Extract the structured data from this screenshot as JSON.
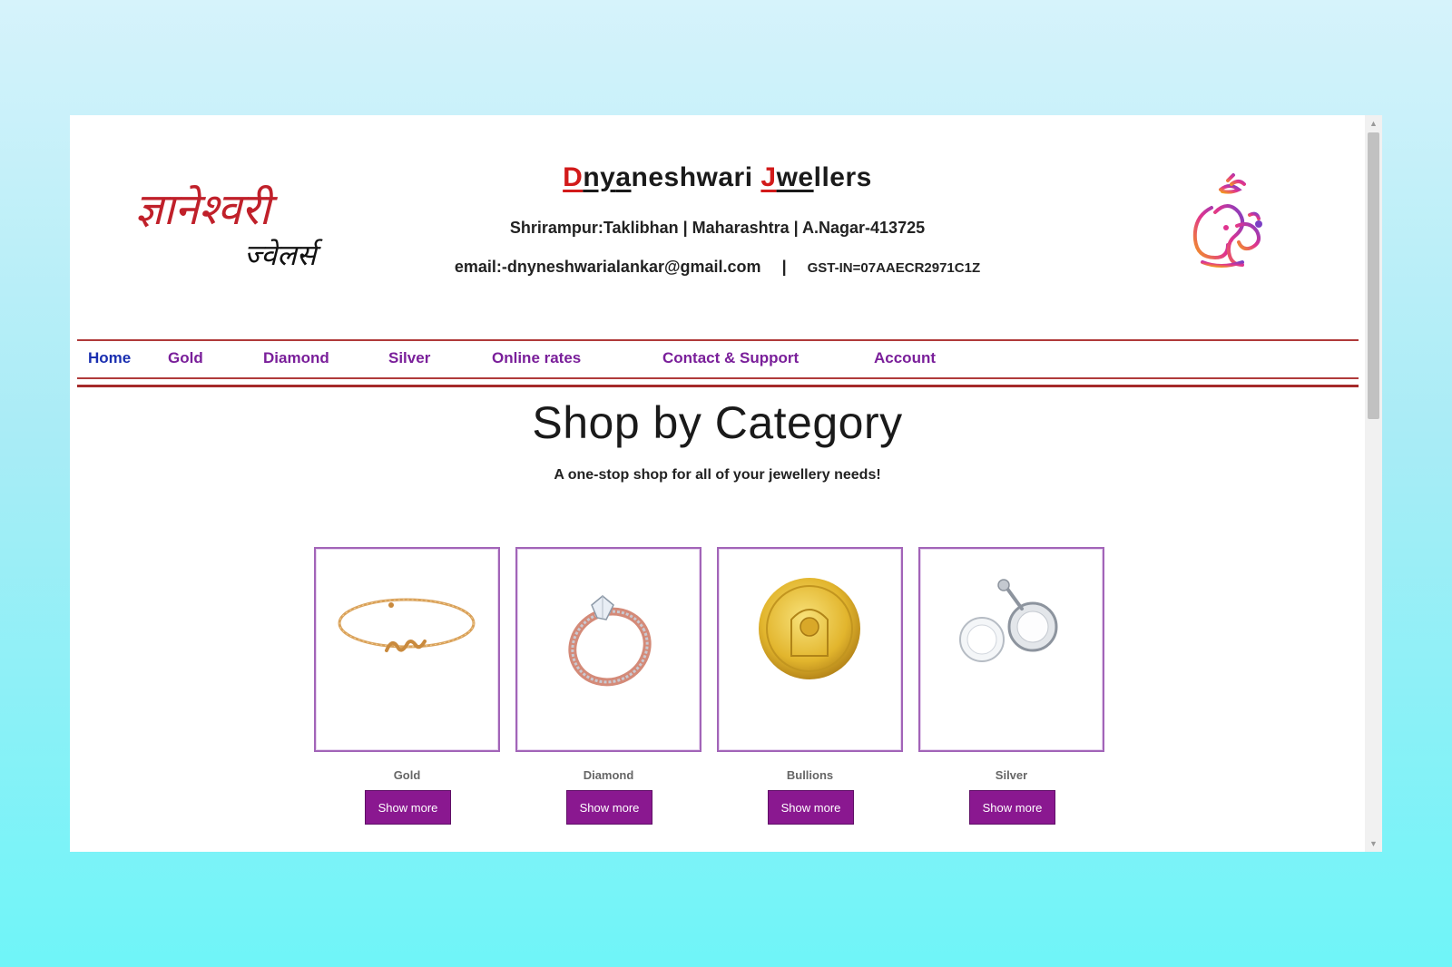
{
  "header": {
    "logo_text_line1": "ज्ञानेश्वरी",
    "logo_text_line2": "ज्वेलर्स",
    "brand": {
      "part1_hl": "D",
      "part2_ul": "ny",
      "part3_ul": "a",
      "part4": "neshwari ",
      "part5_hl": "J",
      "part6_ul": "we",
      "part7": "llers"
    },
    "address": "Shrirampur:Taklibhan | Maharashtra | A.Nagar-413725",
    "email": "email:-dnyneshwarialankar@gmail.com",
    "separator": "|",
    "gst": "GST-IN=07AAECR2971C1Z",
    "right_logo_icon": "ganesha-icon"
  },
  "nav": {
    "items": [
      {
        "label": "Home",
        "active": true
      },
      {
        "label": "Gold"
      },
      {
        "label": "Diamond"
      },
      {
        "label": "Silver"
      },
      {
        "label": "Online rates"
      },
      {
        "label": "Contact & Support"
      },
      {
        "label": "Account"
      }
    ]
  },
  "main": {
    "title": "Shop by Category",
    "subtitle": "A one-stop shop for all of your jewellery needs!",
    "categories": [
      {
        "label": "Gold",
        "button": "Show more",
        "image_icon": "gold-bracelet-icon"
      },
      {
        "label": "Diamond",
        "button": "Show more",
        "image_icon": "diamond-ring-icon"
      },
      {
        "label": "Bullions",
        "button": "Show more",
        "image_icon": "gold-coin-icon"
      },
      {
        "label": "Silver",
        "button": "Show more",
        "image_icon": "silver-earrings-icon"
      }
    ]
  },
  "colors": {
    "accent": "#8a1890",
    "nav_text": "#7a1f9a",
    "nav_active": "#1a2fb0",
    "brand_red": "#d21a1a",
    "rule": "#b03a3a"
  }
}
